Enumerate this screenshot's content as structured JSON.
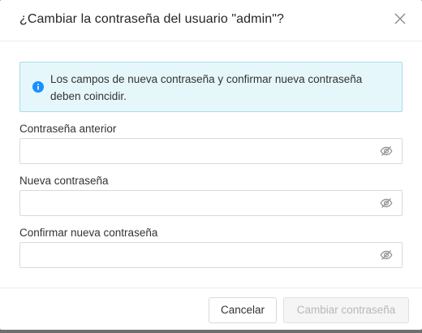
{
  "dialog": {
    "title": "¿Cambiar la contraseña del usuario \"admin\"?",
    "close_icon": "close-icon"
  },
  "alert": {
    "icon": "info-icon",
    "message": "Los campos de nueva contraseña y confirmar nueva contraseña deben coincidir."
  },
  "fields": [
    {
      "label": "Contraseña anterior",
      "value": "",
      "icon": "eye-slash-icon"
    },
    {
      "label": "Nueva contraseña",
      "value": "",
      "icon": "eye-slash-icon"
    },
    {
      "label": "Confirmar nueva contraseña",
      "value": "",
      "icon": "eye-slash-icon"
    }
  ],
  "footer": {
    "cancel_label": "Cancelar",
    "submit_label": "Cambiar contraseña"
  },
  "colors": {
    "alert_bg": "#e6f7fb",
    "alert_border": "#a8dcea",
    "info_icon": "#1890ff",
    "disabled_text": "#b8b8b8"
  }
}
